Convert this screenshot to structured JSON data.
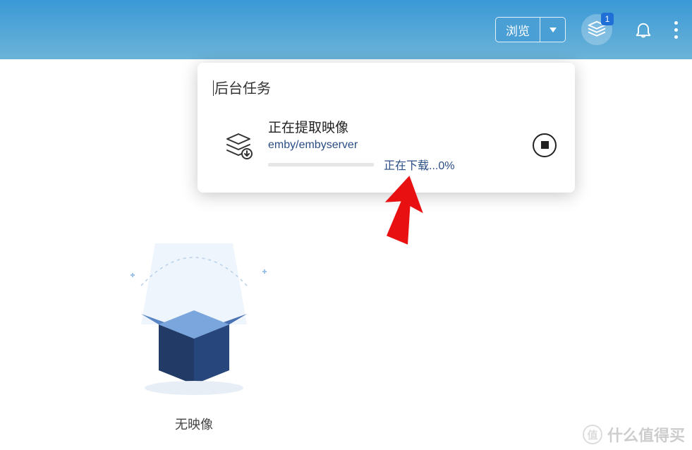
{
  "header": {
    "browse_label": "浏览",
    "tasks_badge": "1"
  },
  "popover": {
    "title": "后台任务",
    "task": {
      "title": "正在提取映像",
      "subtitle": "emby/embyserver",
      "progress_text": "正在下载...0%",
      "progress_percent": 0
    }
  },
  "empty": {
    "label": "无映像"
  },
  "watermark": {
    "text": "什么值得买"
  }
}
